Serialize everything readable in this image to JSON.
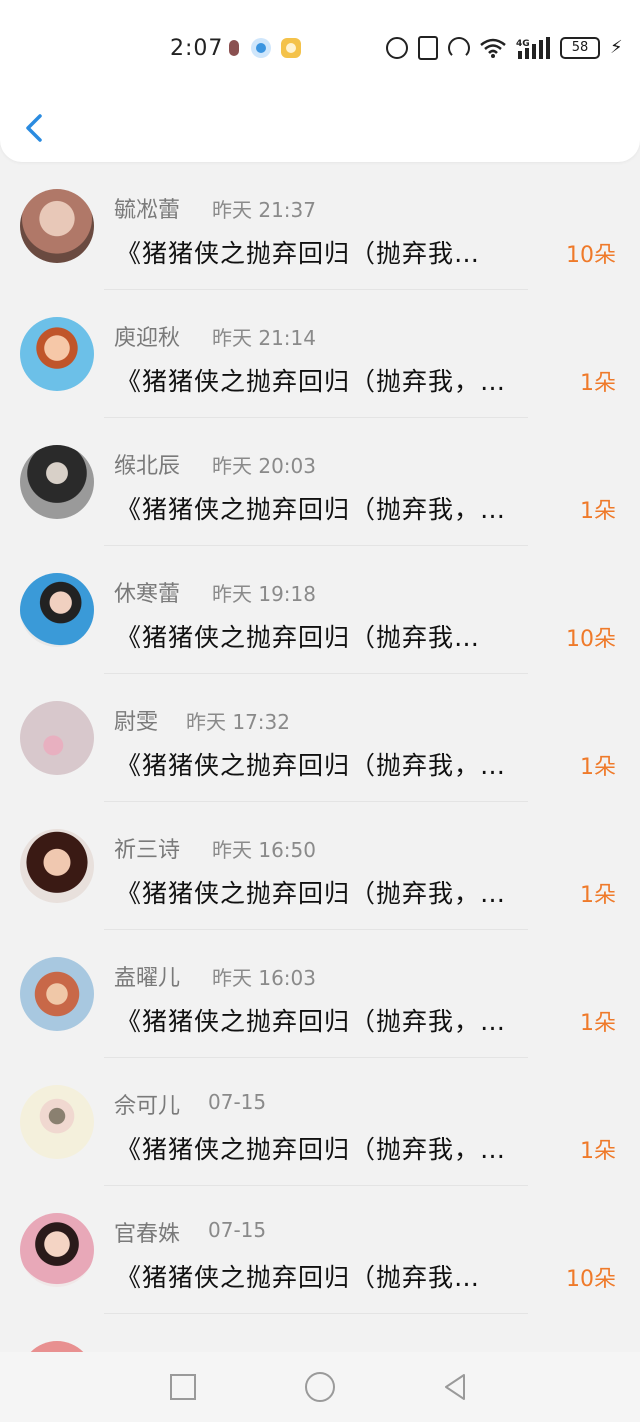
{
  "status_bar": {
    "time": "2:07",
    "battery": "58",
    "network": "4G"
  },
  "list": [
    {
      "name": "毓凇蕾",
      "time": "昨天 21:37",
      "message": "《猪猪侠之抛弃回归（抛弃我…",
      "count": "10朵",
      "avatar_color": "#b07868"
    },
    {
      "name": "庾迎秋",
      "time": "昨天 21:14",
      "message": "《猪猪侠之抛弃回归（抛弃我，…",
      "count": "1朵",
      "avatar_color": "#6cc0e8"
    },
    {
      "name": "缑北辰",
      "time": "昨天 20:03",
      "message": "《猪猪侠之抛弃回归（抛弃我，…",
      "count": "1朵",
      "avatar_color": "#5a5a5a"
    },
    {
      "name": "休寒蕾",
      "time": "昨天 19:18",
      "message": "《猪猪侠之抛弃回归（抛弃我…",
      "count": "10朵",
      "avatar_color": "#3a9ad8"
    },
    {
      "name": "尉雯",
      "time": "昨天 17:32",
      "message": "《猪猪侠之抛弃回归（抛弃我，…",
      "count": "1朵",
      "avatar_color": "#d8c8cc"
    },
    {
      "name": "祈三诗",
      "time": "昨天 16:50",
      "message": "《猪猪侠之抛弃回归（抛弃我，…",
      "count": "1朵",
      "avatar_color": "#8a4a3a"
    },
    {
      "name": "盍曜儿",
      "time": "昨天 16:03",
      "message": "《猪猪侠之抛弃回归（抛弃我，…",
      "count": "1朵",
      "avatar_color": "#c86848"
    },
    {
      "name": "佘可儿",
      "time": "07-15",
      "message": "《猪猪侠之抛弃回归（抛弃我，…",
      "count": "1朵",
      "avatar_color": "#e8e0c0"
    },
    {
      "name": "官春姝",
      "time": "07-15",
      "message": "《猪猪侠之抛弃回归（抛弃我…",
      "count": "10朵",
      "avatar_color": "#c89090"
    }
  ],
  "colors": {
    "accent": "#2a8be0",
    "count": "#ef7a2a",
    "name": "#7a7a7a"
  },
  "icons": {
    "back": "chevron-left-icon",
    "nav_recent": "square-icon",
    "nav_home": "circle-icon",
    "nav_back": "triangle-back-icon"
  }
}
